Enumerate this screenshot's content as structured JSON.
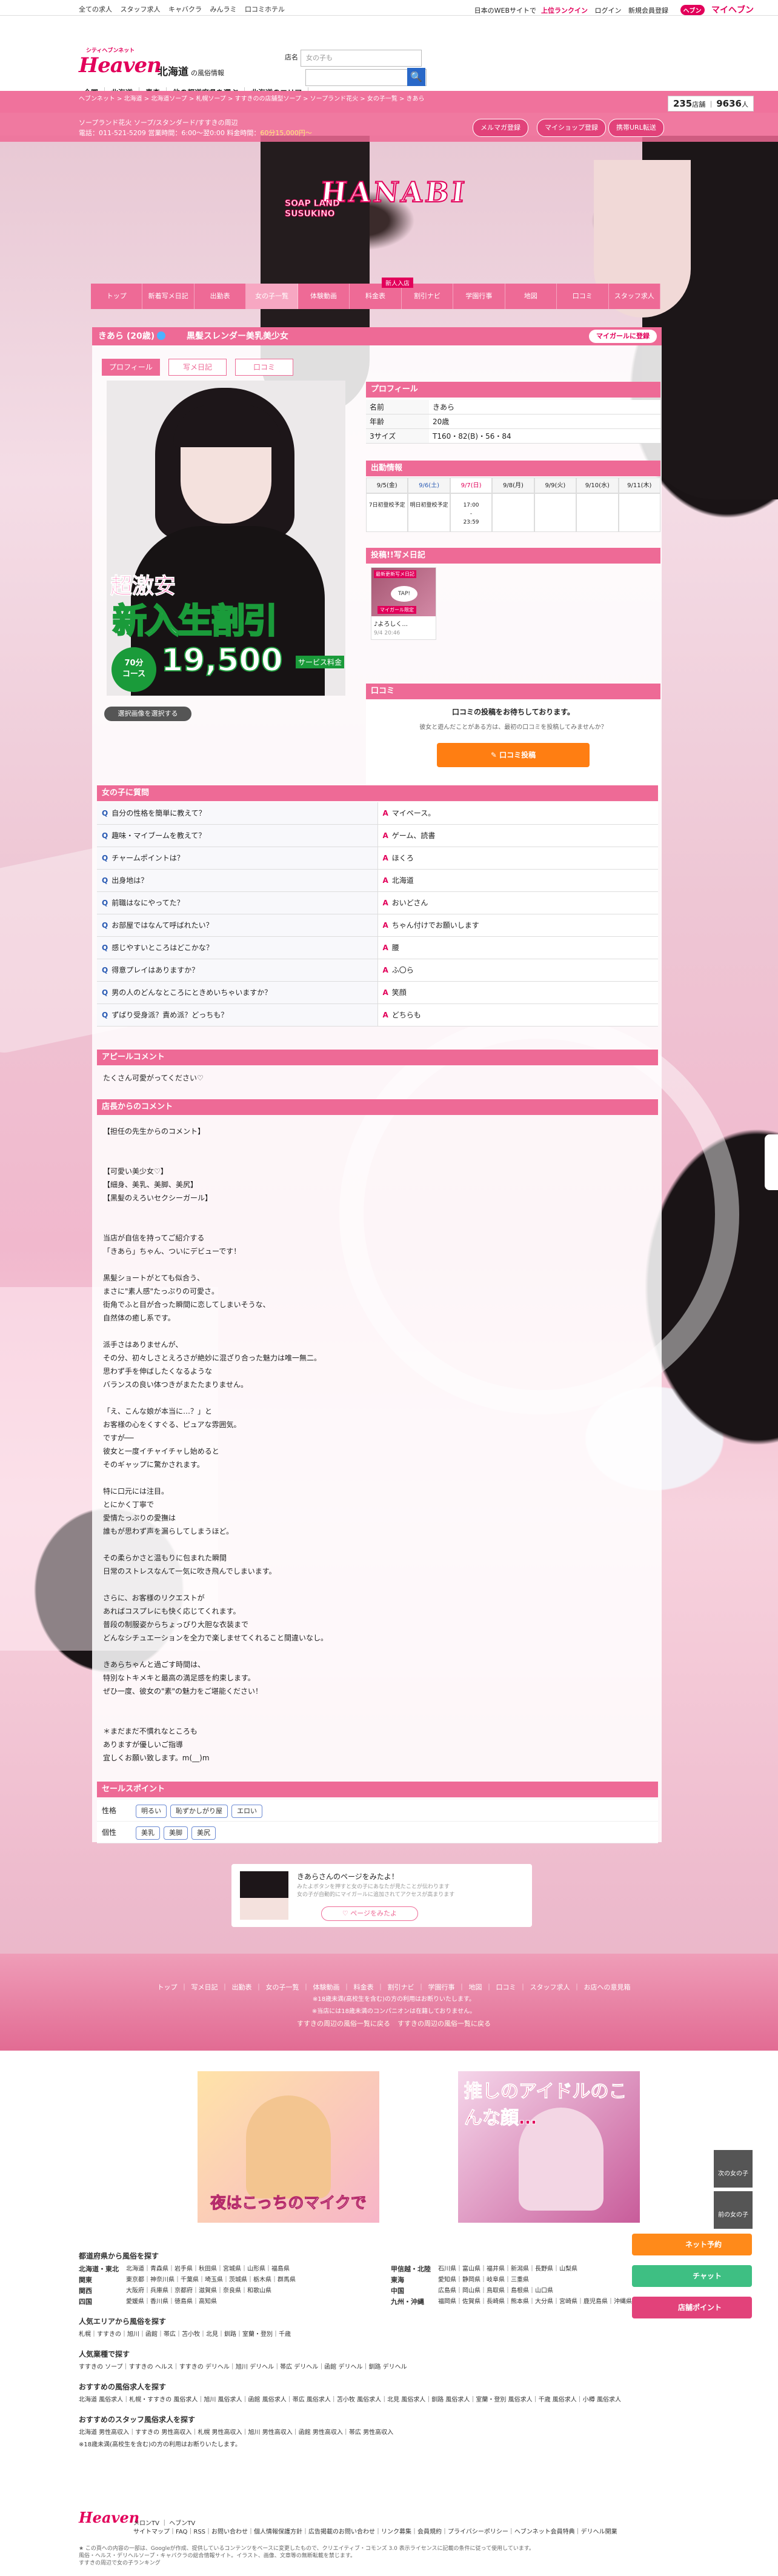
{
  "topbar": {
    "links": [
      "全ての求人",
      "スタッフ求人",
      "キャバクラ",
      "みんラミ",
      "口コミホテル"
    ],
    "notice": "日本のWEBサイトで",
    "rank": "上位ランクイン",
    "login": "ログイン",
    "register": "新規会員登録",
    "heaven_badge": "ヘブン",
    "heaven_text": "マイヘブン"
  },
  "header": {
    "logo": "Heaven",
    "logo_sub": "シティヘブンネット",
    "region": "北海道",
    "region_sub": "の風俗情報",
    "search_label": "店名",
    "search_placeholder": "女の子も",
    "search_btn": "🔍",
    "nav": [
      "全国",
      "北海道",
      "青森",
      "他の都道府県を選ぶ",
      "北海道のエリア"
    ],
    "counts_shops": "235",
    "counts_shops_unit": "店舗",
    "counts_girls": "9636",
    "counts_girls_unit": "人"
  },
  "breadcrumb": "ヘブンネット > 北海道 > 北海道ソープ > 札幌ソープ > すすきのの店舗型ソープ > ソープランド花火 > 女の子一覧 > きあら",
  "shop": {
    "line1": "ソープランド花火 ソープ/スタンダード/すすきの周辺",
    "line2_a": "電話：011-521-5209 営業時間：6:00〜翌0:00 料金時間：",
    "line2_b": "60分15,000円〜",
    "buttons": [
      "メルマガ登録",
      "マイショップ登録",
      "携帯URL転送"
    ]
  },
  "hero": {
    "logo": "HANABI",
    "logo_sub": "SOAP LAND\nSUSUKINO"
  },
  "shopnav": {
    "new_badge": "新人入店",
    "items": [
      "トップ",
      "新着写メ日記",
      "出勤表",
      "女の子一覧",
      "体験動画",
      "料金表",
      "割引ナビ",
      "学園行事",
      "地図",
      "口コミ",
      "スタッフ求人"
    ]
  },
  "girl": {
    "name": "きあら (20歳)",
    "catch": "黒髪スレンダー美乳美少女",
    "fav": "マイガールに登録",
    "tabs": [
      "プロフィール",
      "写メ日記",
      "口コミ"
    ],
    "photo": {
      "t1": "超激安",
      "t2": "新入生割引",
      "t3": "19,500",
      "c70": "70分\nコース",
      "svc": "サービス料金"
    },
    "change": "選択画像を選択する"
  },
  "profile": {
    "title": "プロフィール",
    "rows": [
      {
        "k": "名前",
        "v": "きあら"
      },
      {
        "k": "年齢",
        "v": "20歳"
      },
      {
        "k": "3サイズ",
        "v": "T160・82(B)・56・84"
      }
    ]
  },
  "schedule": {
    "title": "出勤情報",
    "days": [
      "9/5(金)",
      "9/6(土)",
      "9/7(日)",
      "9/8(月)",
      "9/9(火)",
      "9/10(水)",
      "9/11(木)"
    ],
    "cells": [
      "7日初登校予定",
      "明日初登校予定",
      "17:00\n-\n23:59",
      "",
      "",
      "",
      ""
    ]
  },
  "diary": {
    "title": "投稿!!写メ日記",
    "tag": "最新更新写メ日記",
    "tap": "TAP!",
    "limited": "マイガール限定",
    "caption": "♪よろしく...",
    "date": "9/4 20:46"
  },
  "review": {
    "title": "口コミ",
    "t": "口コミの投稿をお待ちしております。",
    "s": "彼女と遊んだことがある方は、最初の口コミを投稿してみませんか？",
    "btn": "✎ 口コミ投稿"
  },
  "qa": {
    "title": "女の子に質問",
    "rows": [
      {
        "q": "自分の性格を簡単に教えて？",
        "a": "マイペース。"
      },
      {
        "q": "趣味・マイブームを教えて？",
        "a": "ゲーム、読書"
      },
      {
        "q": "チャームポイントは？",
        "a": "ほくろ"
      },
      {
        "q": "出身地は？",
        "a": "北海道"
      },
      {
        "q": "前職はなにやってた？",
        "a": "おいどさん"
      },
      {
        "q": "お部屋ではなんて呼ばれたい？",
        "a": "ちゃん付けでお願いします"
      },
      {
        "q": "感じやすいところはどこかな？",
        "a": "腰"
      },
      {
        "q": "得意プレイはありますか？",
        "a": "ふ〇ら"
      },
      {
        "q": "男の人のどんなところにときめいちゃいますか？",
        "a": "笑顔"
      },
      {
        "q": "ずばり受身派？責め派？どっちも？",
        "a": "どちらも"
      }
    ]
  },
  "appeal": {
    "title": "アピールコメント",
    "text": "たくさん可愛がってください♡"
  },
  "shopcomment": {
    "title": "店長からのコメント",
    "text": "【担任の先生からのコメント】\n\n\n【可愛い美少女♡】\n【細身、美乳、美脚、美尻】\n【黒髪のえろいセクシーガール】\n\n\n当店が自信を持ってご紹介する\n「きあら」ちゃん、ついにデビューです！\n\n黒髪ショートがとても似合う、\nまさに\"素人感\"たっぷりの可愛さ。\n街角でふと目が合った瞬間に恋してしまいそうな、\n自然体の癒し系です。\n\n派手さはありませんが、\nその分、初々しさとえろさが絶妙に混ざり合った魅力は唯一無二。\n思わず手を伸ばしたくなるような\nバランスの良い体つきがまたたまりません。\n\n「え、こんな娘が本当に…？」と\nお客様の心をくすぐる、ピュアな雰囲気。\nですが──\n彼女と一度イチャイチャし始めると\nそのギャップに驚かされます。\n\n特に口元には注目。\nとにかく丁寧で\n愛情たっぷりの愛撫は\n誰もが思わず声を漏らしてしまうほど。\n\nその柔らかさと温もりに包まれた瞬間\n日常のストレスなんて一気に吹き飛んでしまいます。\n\nさらに、お客様のリクエストが\nあればコスプレにも快く応じてくれます。\n普段の制服姿からちょっぴり大胆な衣装まで\nどんなシチュエーションを全力で楽しませてくれること間違いなし。\n\nきあらちゃんと過ごす時間は、\n特別なトキメキと最高の満足感を約束します。\nぜひ一度、彼女の\"素\"の魅力をご堪能ください！\n\n\n＊まだまだ不慣れなところも\nありますが優しいご指導\n宜しくお願い致します。m(__)m"
  },
  "sales": {
    "title": "セールスポイント",
    "rows": [
      {
        "k": "性格",
        "tags": [
          "明るい",
          "恥ずかしがり屋",
          "エロい"
        ]
      },
      {
        "k": "個性",
        "tags": [
          "美乳",
          "美脚",
          "美尻"
        ]
      }
    ]
  },
  "share": {
    "t": "きあらさんのページをみたよ！",
    "s": "みたよボタンを押すと女の子にあなたが見たことが伝わります\n女の子が自動的にマイガールに追加されてアクセスが高まります",
    "btn": "♡ ページをみたよ"
  },
  "footnav": {
    "items": [
      "トップ",
      "写メ日記",
      "出勤表",
      "女の子一覧",
      "体験動画",
      "料金表",
      "割引ナビ",
      "学園行事",
      "地図",
      "口コミ",
      "スタッフ求人",
      "お店への意見箱"
    ],
    "note1": "※18歳未満(高校生を含む)の方の利用はお断りいたします。",
    "note2": "※当店には18歳未満のコンパニオンは在籍しておりません。",
    "links": [
      "すすきの周辺の風俗一覧に戻る",
      "すすきの周辺の風俗一覧に戻る"
    ]
  },
  "ads": [
    {
      "cap": "夜はこっちのマイクで"
    },
    {
      "cap2": "推しのアイドルのこんな顔…"
    }
  ],
  "floating": [
    {
      "label": "ネット予約",
      "color": "#ff8a1a"
    },
    {
      "label": "チャット",
      "color": "#3ebf83"
    },
    {
      "label": "店舗ポイント",
      "color": "#e2427a"
    }
  ],
  "sidebtns": [
    "次の女の子",
    "前の女の子"
  ],
  "footer_links": {
    "h_pref": "都道府県から風俗を探す",
    "regions": [
      {
        "k": "北海道・東北",
        "v": "北海道｜青森県｜岩手県｜秋田県｜宮城県｜山形県｜福島県"
      },
      {
        "k": "甲信越・北陸",
        "v": "石川県｜富山県｜福井県｜新潟県｜長野県｜山梨県"
      },
      {
        "k": "関東",
        "v": "東京都｜神奈川県｜千葉県｜埼玉県｜茨城県｜栃木県｜群馬県"
      },
      {
        "k": "東海",
        "v": "愛知県｜静岡県｜岐阜県｜三重県"
      },
      {
        "k": "関西",
        "v": "大阪府｜兵庫県｜京都府｜滋賀県｜奈良県｜和歌山県"
      },
      {
        "k": "中国",
        "v": "広島県｜岡山県｜鳥取県｜島根県｜山口県"
      },
      {
        "k": "四国",
        "v": "愛媛県｜香川県｜徳島県｜高知県"
      },
      {
        "k": "九州・沖縄",
        "v": "福岡県｜佐賀県｜長崎県｜熊本県｜大分県｜宮崎県｜鹿児島県｜沖縄県"
      }
    ],
    "h_area": "人気エリアから風俗を探す",
    "area": "札幌｜すすきの｜旭川｜函館｜帯広｜苫小牧｜北見｜釧路｜室蘭・登別｜千歳",
    "h_genre": "人気業種で探す",
    "genre": "すすきの ソープ｜すすきの ヘルス｜すすきの デリヘル｜旭川 デリヘル｜帯広 デリヘル｜函館 デリヘル｜釧路 デリヘル",
    "h_job": "おすすめの風俗求人を探す",
    "job": "北海道 風俗求人｜札幌・すすきの 風俗求人｜旭川 風俗求人｜函館 風俗求人｜帯広 風俗求人｜苫小牧 風俗求人｜北見 風俗求人｜釧路 風俗求人｜室蘭・登別 風俗求人｜千歳 風俗求人｜小樽 風俗求人",
    "h_staff": "おすすめのスタッフ風俗求人を探す",
    "staff": "北海道 男性高収入｜すすきの 男性高収入｜札幌 男性高収入｜旭川 男性高収入｜函館 男性高収入｜帯広 男性高収入",
    "note": "※18歳未満(高校生を含む)の方の利用はお断りいたします。"
  },
  "footer": {
    "logo": "Heaven",
    "links": "メロンTV ｜ ヘブンTV\nサイトマップ｜FAQ｜RSS｜お問い合わせ｜個人情報保護方針｜広告掲載のお問い合わせ｜リンク募集｜会員規約｜プライバシーポリシー｜ヘブンネット会員特典｜デリヘル開業",
    "copy": "★ この頁への内容の一部は、Googleが作成、提供しているコンテンツをベースに変更したもので、クリエイティブ・コモンズ 3.0 表示ライセンスに記載の条件に従って使用しています。\n風俗・ヘルス・デリヘルソープ・キャバクラの総合情報サイト。イラスト、画像、文章等の無断転載を禁じます。\nすすきの周辺で女の子ランキング"
  }
}
